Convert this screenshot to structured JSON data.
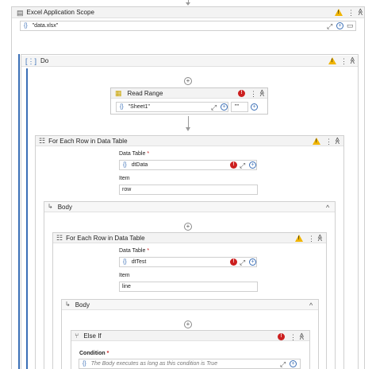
{
  "excel_scope": {
    "title": "Excel Application Scope",
    "path_value": "\"data.xlsx\""
  },
  "do_seq": {
    "title": "Do"
  },
  "read_range": {
    "title": "Read Range",
    "sheet_value": "\"Sheet1\"",
    "range_value": "\"\""
  },
  "foreach1": {
    "title": "For Each Row in Data Table",
    "data_table_label": "Data Table",
    "data_table_value": "dtData",
    "item_label": "Item",
    "item_value": "row"
  },
  "body1": {
    "title": "Body"
  },
  "foreach2": {
    "title": "For Each Row in Data Table",
    "data_table_label": "Data Table",
    "data_table_value": "dtTest",
    "item_label": "Item",
    "item_value": "line"
  },
  "body2": {
    "title": "Body"
  },
  "elseif": {
    "title": "Else If",
    "condition_label": "Condition",
    "condition_placeholder": "The Body executes as long as this condition is True"
  },
  "symbols": {
    "required": "*",
    "brace": "{}",
    "ellipsis": "⋮",
    "collapse": "≪",
    "expand": "^",
    "plus": "+",
    "error": "!",
    "body_arrow": "↳"
  },
  "colors": {
    "accent": "#3b6fb6",
    "warning": "#f0b400",
    "error": "#cc1f1f",
    "header_bg": "#f3f3f3"
  },
  "icons": [
    "excel-scope-icon",
    "sequence-icon",
    "read-range-icon",
    "for-each-icon",
    "else-if-icon",
    "warning-icon",
    "error-icon",
    "more-options-icon",
    "collapse-icon",
    "expression-editor-icon",
    "folder-icon",
    "add-activity-icon"
  ]
}
